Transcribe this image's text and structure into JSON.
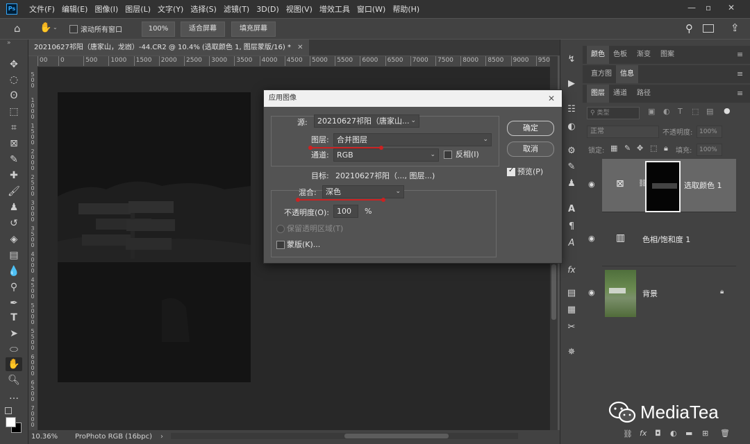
{
  "app": {
    "logo": "Ps"
  },
  "menubar": {
    "items": [
      "文件(F)",
      "编辑(E)",
      "图像(I)",
      "图层(L)",
      "文字(Y)",
      "选择(S)",
      "滤镜(T)",
      "3D(D)",
      "视图(V)",
      "增效工具",
      "窗口(W)",
      "帮助(H)"
    ]
  },
  "options": {
    "scroll_all": "滚动所有窗口",
    "zoom_value": "100%",
    "fit_screen": "适合屏幕",
    "fill_screen": "填充屏幕"
  },
  "document": {
    "tab_title": "20210627祁阳（唐家山，龙凼）-44.CR2 @ 10.4% (选取颜色 1, 图层蒙版/16) *"
  },
  "ruler": {
    "h_ticks": [
      "00",
      "0",
      "500",
      "1000",
      "1500",
      "2000",
      "2500",
      "3000",
      "3500",
      "4000",
      "4500",
      "5000",
      "5500",
      "6000",
      "6500",
      "7000",
      "7500",
      "8000",
      "8500",
      "9000",
      "950"
    ],
    "v_ticks": [
      "500",
      "1000",
      "1500",
      "2000",
      "2500",
      "3000",
      "3500",
      "4000",
      "4500",
      "5000",
      "5500",
      "6000",
      "6500",
      "7000"
    ]
  },
  "status": {
    "zoom": "10.36%",
    "profile": "ProPhoto RGB (16bpc)"
  },
  "dialog": {
    "title": "应用图像",
    "source_label": "源:",
    "source_value": "20210627祁阳（唐家山...",
    "layer_label": "图层:",
    "layer_value": "合并图层",
    "channel_label": "通道:",
    "channel_value": "RGB",
    "invert_label": "反相(I)",
    "target_label": "目标:",
    "target_value": "20210627祁阳（..., 图层...)",
    "blend_label": "混合:",
    "blend_value": "深色",
    "opacity_label": "不透明度(O):",
    "opacity_value": "100",
    "opacity_unit": "%",
    "preserve_label": "保留透明区域(T)",
    "mask_label": "蒙版(K)...",
    "ok_label": "确定",
    "cancel_label": "取消",
    "preview_label": "预览(P)"
  },
  "panels": {
    "top_tabs": [
      "颜色",
      "色板",
      "渐变",
      "图案"
    ],
    "mid_tabs": [
      "直方图",
      "信息"
    ],
    "layer_tabs": [
      "图层",
      "通道",
      "路径"
    ],
    "filter_placeholder": "类型",
    "blend_mode": "正常",
    "opacity_label": "不透明度:",
    "opacity_value": "100%",
    "lock_label": "锁定:",
    "fill_label": "填充:",
    "fill_value": "100%"
  },
  "layers": [
    {
      "name": "选取颜色 1",
      "selected": true
    },
    {
      "name": "色相/饱和度 1",
      "selected": false
    },
    {
      "name": "背景",
      "selected": false
    }
  ],
  "watermark": {
    "text": "MediaTea"
  },
  "colors": {
    "accent_blue": "#31a8ff",
    "annotation_red": "#cc2222",
    "panel_bg": "#424242",
    "canvas_bg": "#282828"
  }
}
